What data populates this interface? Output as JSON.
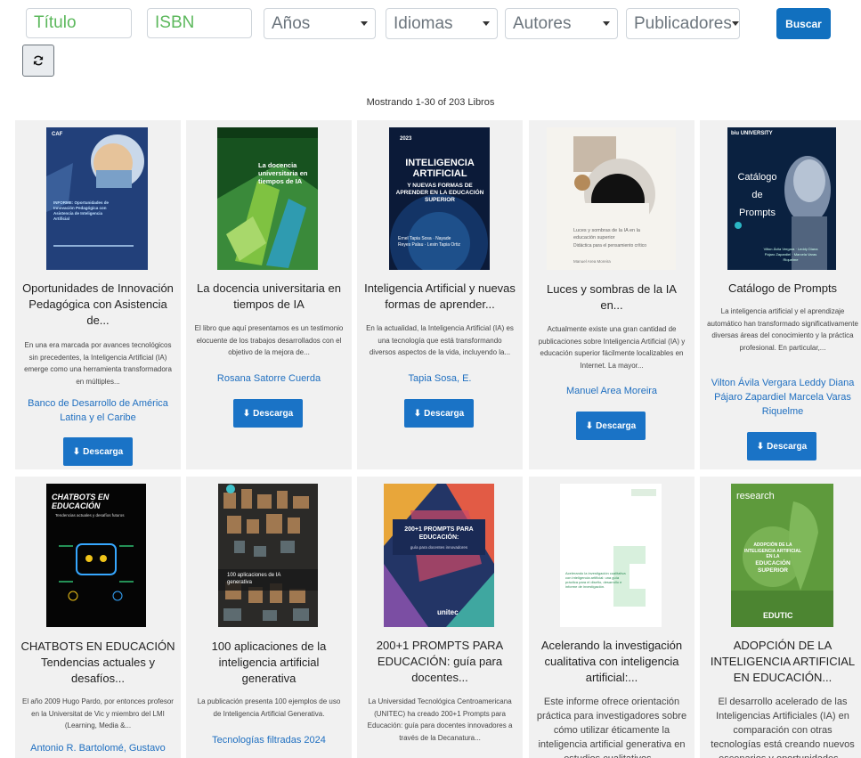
{
  "filters": {
    "title_placeholder": "Título",
    "isbn_placeholder": "ISBN",
    "years_label": "Años",
    "languages_label": "Idiomas",
    "authors_label": "Autores",
    "publishers_label": "Publicadores",
    "search_label": "Buscar"
  },
  "results_text": "Mostrando 1-30 of 203 Libros",
  "download_label": "Descarga",
  "colors": {
    "accent": "#1170bf",
    "link": "#1f6fc0",
    "placeholder": "#5cb85c",
    "card_bg": "#f1f1f1"
  },
  "books": [
    {
      "title": "Oportunidades de Innovación Pedagógica con Asistencia de...",
      "desc": "En una era marcada por avances tecnológicos sin precedentes, la Inteligencia Artificial (IA) emerge como una herramienta transformadora en múltiples...",
      "author": "Banco de Desarrollo de América Latina y el Caribe",
      "cover": {
        "brand": "CAF",
        "heading": "INFORME: Oportunidades de Innovación Pedagógica con Asistencia de Inteligencia Artificial"
      }
    },
    {
      "title": "La docencia universitaria en tiempos de IA",
      "desc": "El libro que aquí presentamos es un testimonio elocuente de los trabajos desarrollados con el objetivo de la mejora de...",
      "author": "Rosana Satorre Cuerda",
      "cover": {
        "heading": "La docencia universitaria en tiempos de IA",
        "big": "IA"
      }
    },
    {
      "title": "Inteligencia Artificial y nuevas formas de aprender...",
      "desc": "En la actualidad, la Inteligencia Artificial (IA) es una tecnología que está transformando diversos aspectos de la vida, incluyendo la...",
      "author": "Tapia Sosa, E.",
      "cover": {
        "year": "2023",
        "heading": "INTELIGENCIA ARTIFICIAL",
        "sub": "Y NUEVAS FORMAS DE APRENDER EN LA EDUCACIÓN SUPERIOR",
        "names": "Ernel Tapia Sosa · Nayade Reyes Palau · Lesin Tapia Ortiz"
      }
    },
    {
      "title": "Luces y sombras de la IA en...",
      "desc": "Actualmente existe una gran cantidad de publicaciones sobre Inteligencia Artificial (IA) y educación superior fácilmente localizables en Internet. La mayor...",
      "author": "Manuel Area Moreira",
      "cover": {
        "heading": "Luces y sombras de la IA en la educación superior",
        "sub": "Didáctica para el pensamiento crítico",
        "names": "Manuel Area Moreira"
      }
    },
    {
      "title": "Catálogo de Prompts",
      "desc": "La inteligencia artificial y el aprendizaje automático han transformado significativamente diversas áreas del conocimiento y la práctica profesional. En particular,...",
      "author": "Vilton Ávila Vergara Leddy Diana Pájaro Zapardiel Marcela Varas Riquelme",
      "cover": {
        "brand": "biu UNIVERSITY",
        "heading": "Catálogo de Prompts",
        "names": "Vilton Ávila Vergara · Leddy Diana Pájaro Zapardiel · Marcela Varas Riquelme"
      }
    },
    {
      "title": "CHATBOTS EN EDUCACIÓN Tendencias actuales y desafíos...",
      "desc": "El año 2009 Hugo Pardo, por entonces profesor en la Universitat de Vic y miembro del LMI (Learning, Media &...",
      "author": "Antonio R. Bartolomé, Gustavo",
      "cover": {
        "heading": "CHATBOTS EN EDUCACIÓN",
        "sub": "Tendencias actuales y desafíos futuros"
      }
    },
    {
      "title": "100 aplicaciones de la inteligencia artificial generativa",
      "desc": "La publicación presenta 100 ejemplos de uso de Inteligencia Artificial Generativa.",
      "author": "Tecnologías filtradas 2024",
      "cover": {
        "heading": "100 aplicaciones de IA generativa"
      }
    },
    {
      "title": "200+1 PROMPTS PARA EDUCACIÓN: guía para docentes...",
      "desc": "La Universidad Tecnológica Centroamericana (UNITEC) ha creado 200+1 Prompts para Educación: guía para docentes innovadores a través de la Decanatura...",
      "author": "",
      "cover": {
        "heading": "200+1 PROMPTS PARA EDUCACIÓN:",
        "sub": "guía para docentes innovadores",
        "brand": "unitec"
      }
    },
    {
      "title": "Acelerando la investigación cualitativa con inteligencia artificial:...",
      "desc": "Este informe ofrece orientación práctica para investigadores sobre cómo utilizar éticamente la inteligencia artificial generativa en estudios cualitativos...",
      "author": "",
      "cover": {
        "heading": "Acelerando la investigación cualitativa con inteligencia artificial: una guía práctica para el diseño, desarrollo e informe de investigación."
      }
    },
    {
      "title": "ADOPCIÓN DE LA INTELIGENCIA ARTIFICIAL EN EDUCACIÓN...",
      "desc": "El desarrollo acelerado de las Inteligencias Artificiales (IA) en comparación con otras tecnologías está creando nuevos escenarios y oportunidades...",
      "author": "",
      "cover": {
        "brand": "research",
        "heading": "ADOPCIÓN DE LA INTELIGENCIA ARTIFICIAL EN LA",
        "sub": "EDUCACIÓN SUPERIOR",
        "names": "EDUTIC"
      }
    }
  ]
}
